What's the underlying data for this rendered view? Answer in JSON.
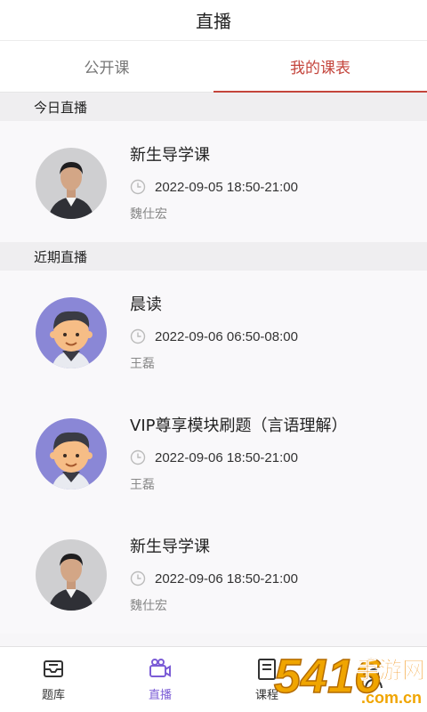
{
  "header": {
    "title": "直播"
  },
  "tabs": [
    {
      "label": "公开课",
      "active": false
    },
    {
      "label": "我的课表",
      "active": true
    }
  ],
  "sections": [
    {
      "title": "今日直播",
      "courses": [
        {
          "name": "新生导学课",
          "time": "2022-09-05 18:50-21:00",
          "teacher": "魏仕宏",
          "avatar": "photo-avatar"
        }
      ]
    },
    {
      "title": "近期直播",
      "courses": [
        {
          "name": "晨读",
          "time": "2022-09-06 06:50-08:00",
          "teacher": "王磊",
          "avatar": "cartoon-avatar"
        },
        {
          "name": "VIP尊享模块刷题（言语理解）",
          "time": "2022-09-06 18:50-21:00",
          "teacher": "王磊",
          "avatar": "cartoon-avatar"
        },
        {
          "name": "新生导学课",
          "time": "2022-09-06 18:50-21:00",
          "teacher": "魏仕宏",
          "avatar": "photo-avatar"
        }
      ]
    }
  ],
  "tabbar": [
    {
      "label": "题库",
      "icon": "question-bank-icon",
      "active": false
    },
    {
      "label": "直播",
      "icon": "video-camera-icon",
      "active": true
    },
    {
      "label": "课程",
      "icon": "book-icon",
      "active": false
    },
    {
      "label": "",
      "icon": "person-icon",
      "active": false
    }
  ],
  "watermark": {
    "text": "手游网",
    "number": "5416",
    "domain": ".com.cn"
  },
  "colors": {
    "accent": "#c4453c",
    "tabbar_active": "#7b5cd6",
    "avatar_bg": "#8a87d6"
  }
}
